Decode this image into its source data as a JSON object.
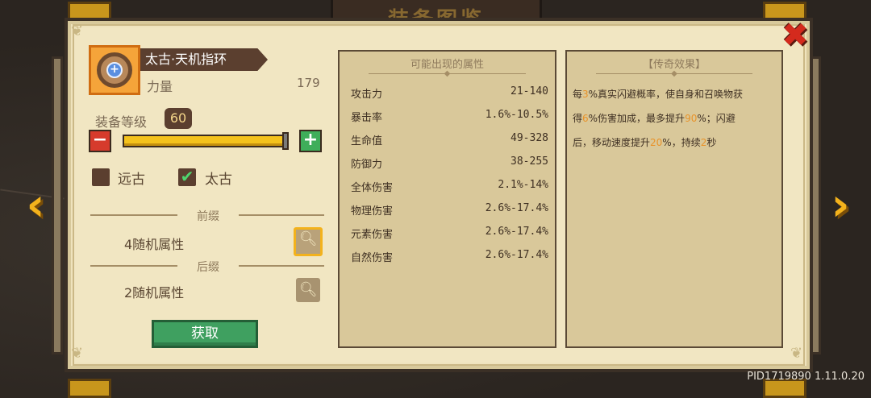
{
  "header": {
    "title": "装备图鉴"
  },
  "item": {
    "name": "太古·天机指环",
    "stat_label": "力量",
    "stat_value": "179"
  },
  "level": {
    "label": "装备等级",
    "value": "60",
    "fill_fraction": 0.98
  },
  "tiers": [
    {
      "label": "远古",
      "checked": false
    },
    {
      "label": "太古",
      "checked": true
    }
  ],
  "prefix": {
    "label": "前缀",
    "text": "4随机属性"
  },
  "suffix": {
    "label": "后缀",
    "text": "2随机属性"
  },
  "acquire_label": "获取",
  "attributes": {
    "title": "可能出现的属性",
    "rows": [
      {
        "name": "攻击力",
        "range": "21-140"
      },
      {
        "name": "暴击率",
        "range": "1.6%-10.5%"
      },
      {
        "name": "生命值",
        "range": "49-328"
      },
      {
        "name": "防御力",
        "range": "38-255"
      },
      {
        "name": "全体伤害",
        "range": "2.1%-14%"
      },
      {
        "name": "物理伤害",
        "range": "2.6%-17.4%"
      },
      {
        "name": "元素伤害",
        "range": "2.6%-17.4%"
      },
      {
        "name": "自然伤害",
        "range": "2.6%-17.4%"
      }
    ]
  },
  "legendary": {
    "title": "【传奇效果】",
    "line1_a": "每",
    "line1_h": "3",
    "line1_b": "%真实闪避概率，使自身和召唤物获",
    "line2_a": "得",
    "line2_h1": "6",
    "line2_b": "%伤害加成，最多提升",
    "line2_h2": "90",
    "line2_c": "%；闪避",
    "line3_a": "后，移动速度提升",
    "line3_h1": "20",
    "line3_b": "%，持续",
    "line3_h2": "2",
    "line3_c": "秒"
  },
  "icons": {
    "close": "close-icon",
    "prev": "chevron-left-icon",
    "next": "chevron-right-icon",
    "minus": "minus-icon",
    "plus": "plus-icon",
    "magnify": "magnify-icon"
  },
  "colors": {
    "panel": "#f1e6c2",
    "accent_gold": "#f3b21c",
    "close_red": "#d42a1d",
    "highlight_orange": "#e8932a",
    "button_green": "#3fa060"
  },
  "version": "PID1719890 1.11.0.20"
}
